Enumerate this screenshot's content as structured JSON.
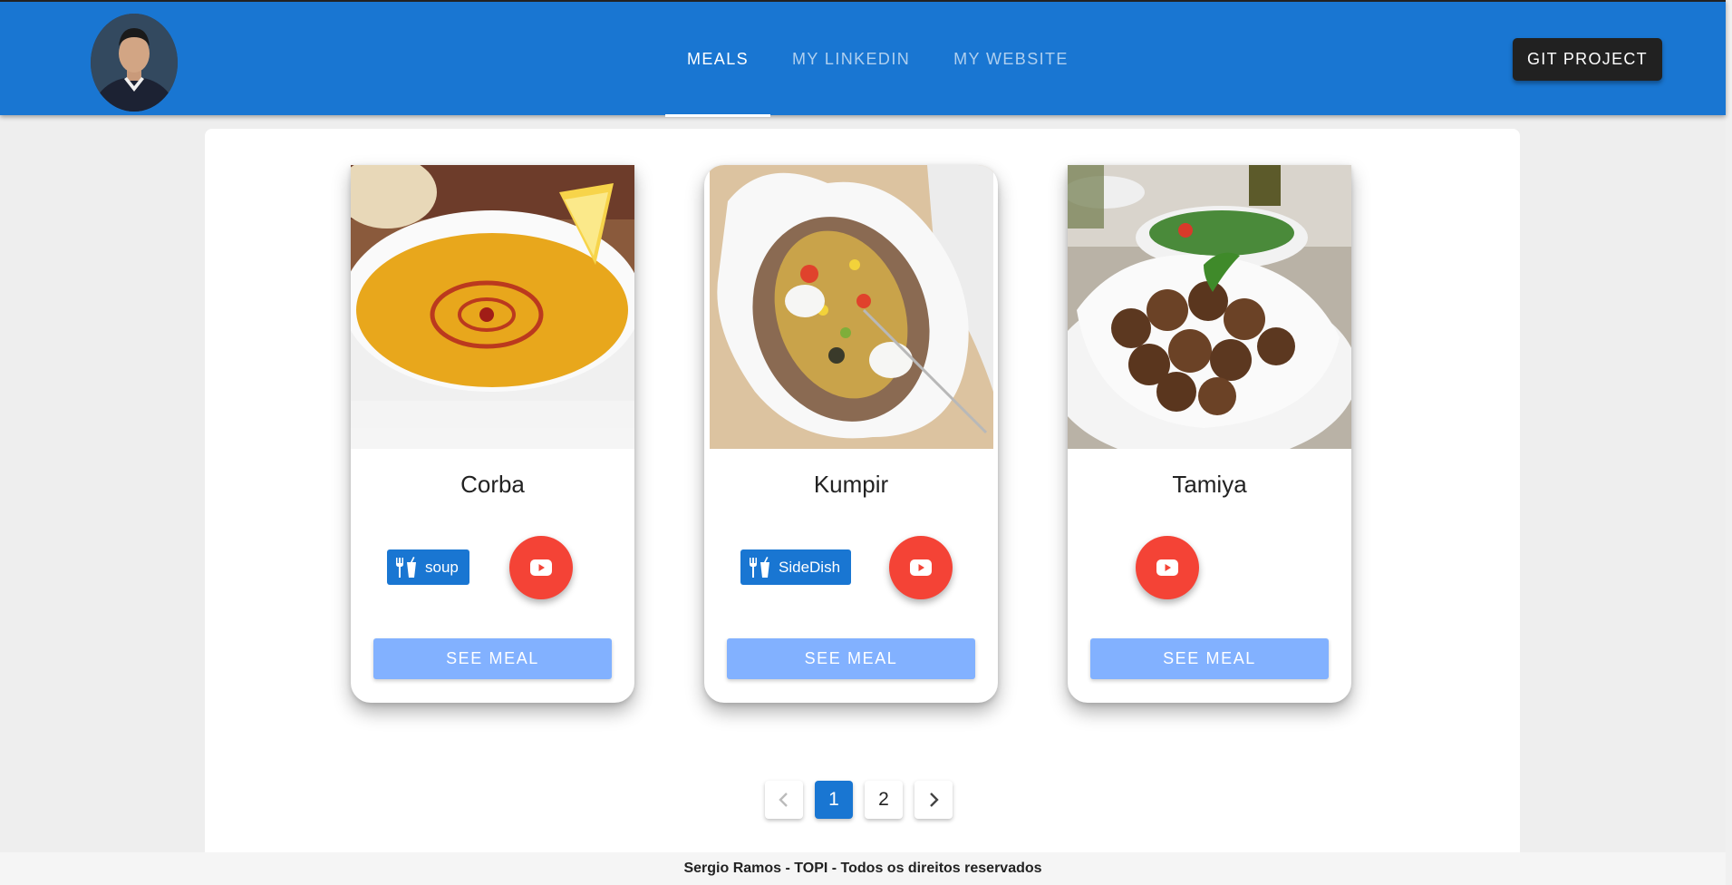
{
  "header": {
    "nav": [
      {
        "label": "MEALS",
        "active": true
      },
      {
        "label": "MY LINKEDIN",
        "active": false
      },
      {
        "label": "MY WEBSITE",
        "active": false
      }
    ],
    "git_button": "GIT PROJECT"
  },
  "meals": [
    {
      "title": "Corba",
      "category": "soup",
      "image_icon": "soup-bowl-photo",
      "see_label": "SEE MEAL"
    },
    {
      "title": "Kumpir",
      "category": "SideDish",
      "image_icon": "baked-potato-photo",
      "see_label": "SEE MEAL"
    },
    {
      "title": "Tamiya",
      "category": "",
      "image_icon": "falafel-photo",
      "see_label": "SEE MEAL"
    }
  ],
  "pagination": {
    "prev_icon": "chevron-left-icon",
    "pages": [
      "1",
      "2"
    ],
    "current": "1",
    "next_icon": "chevron-right-icon"
  },
  "footer": {
    "text": "Sergio Ramos - TOPI - Todos os direitos reservados"
  },
  "colors": {
    "primary": "#1976d2",
    "youtube": "#f44336",
    "see_meal": "#82b1ff",
    "git_button": "#212121"
  }
}
